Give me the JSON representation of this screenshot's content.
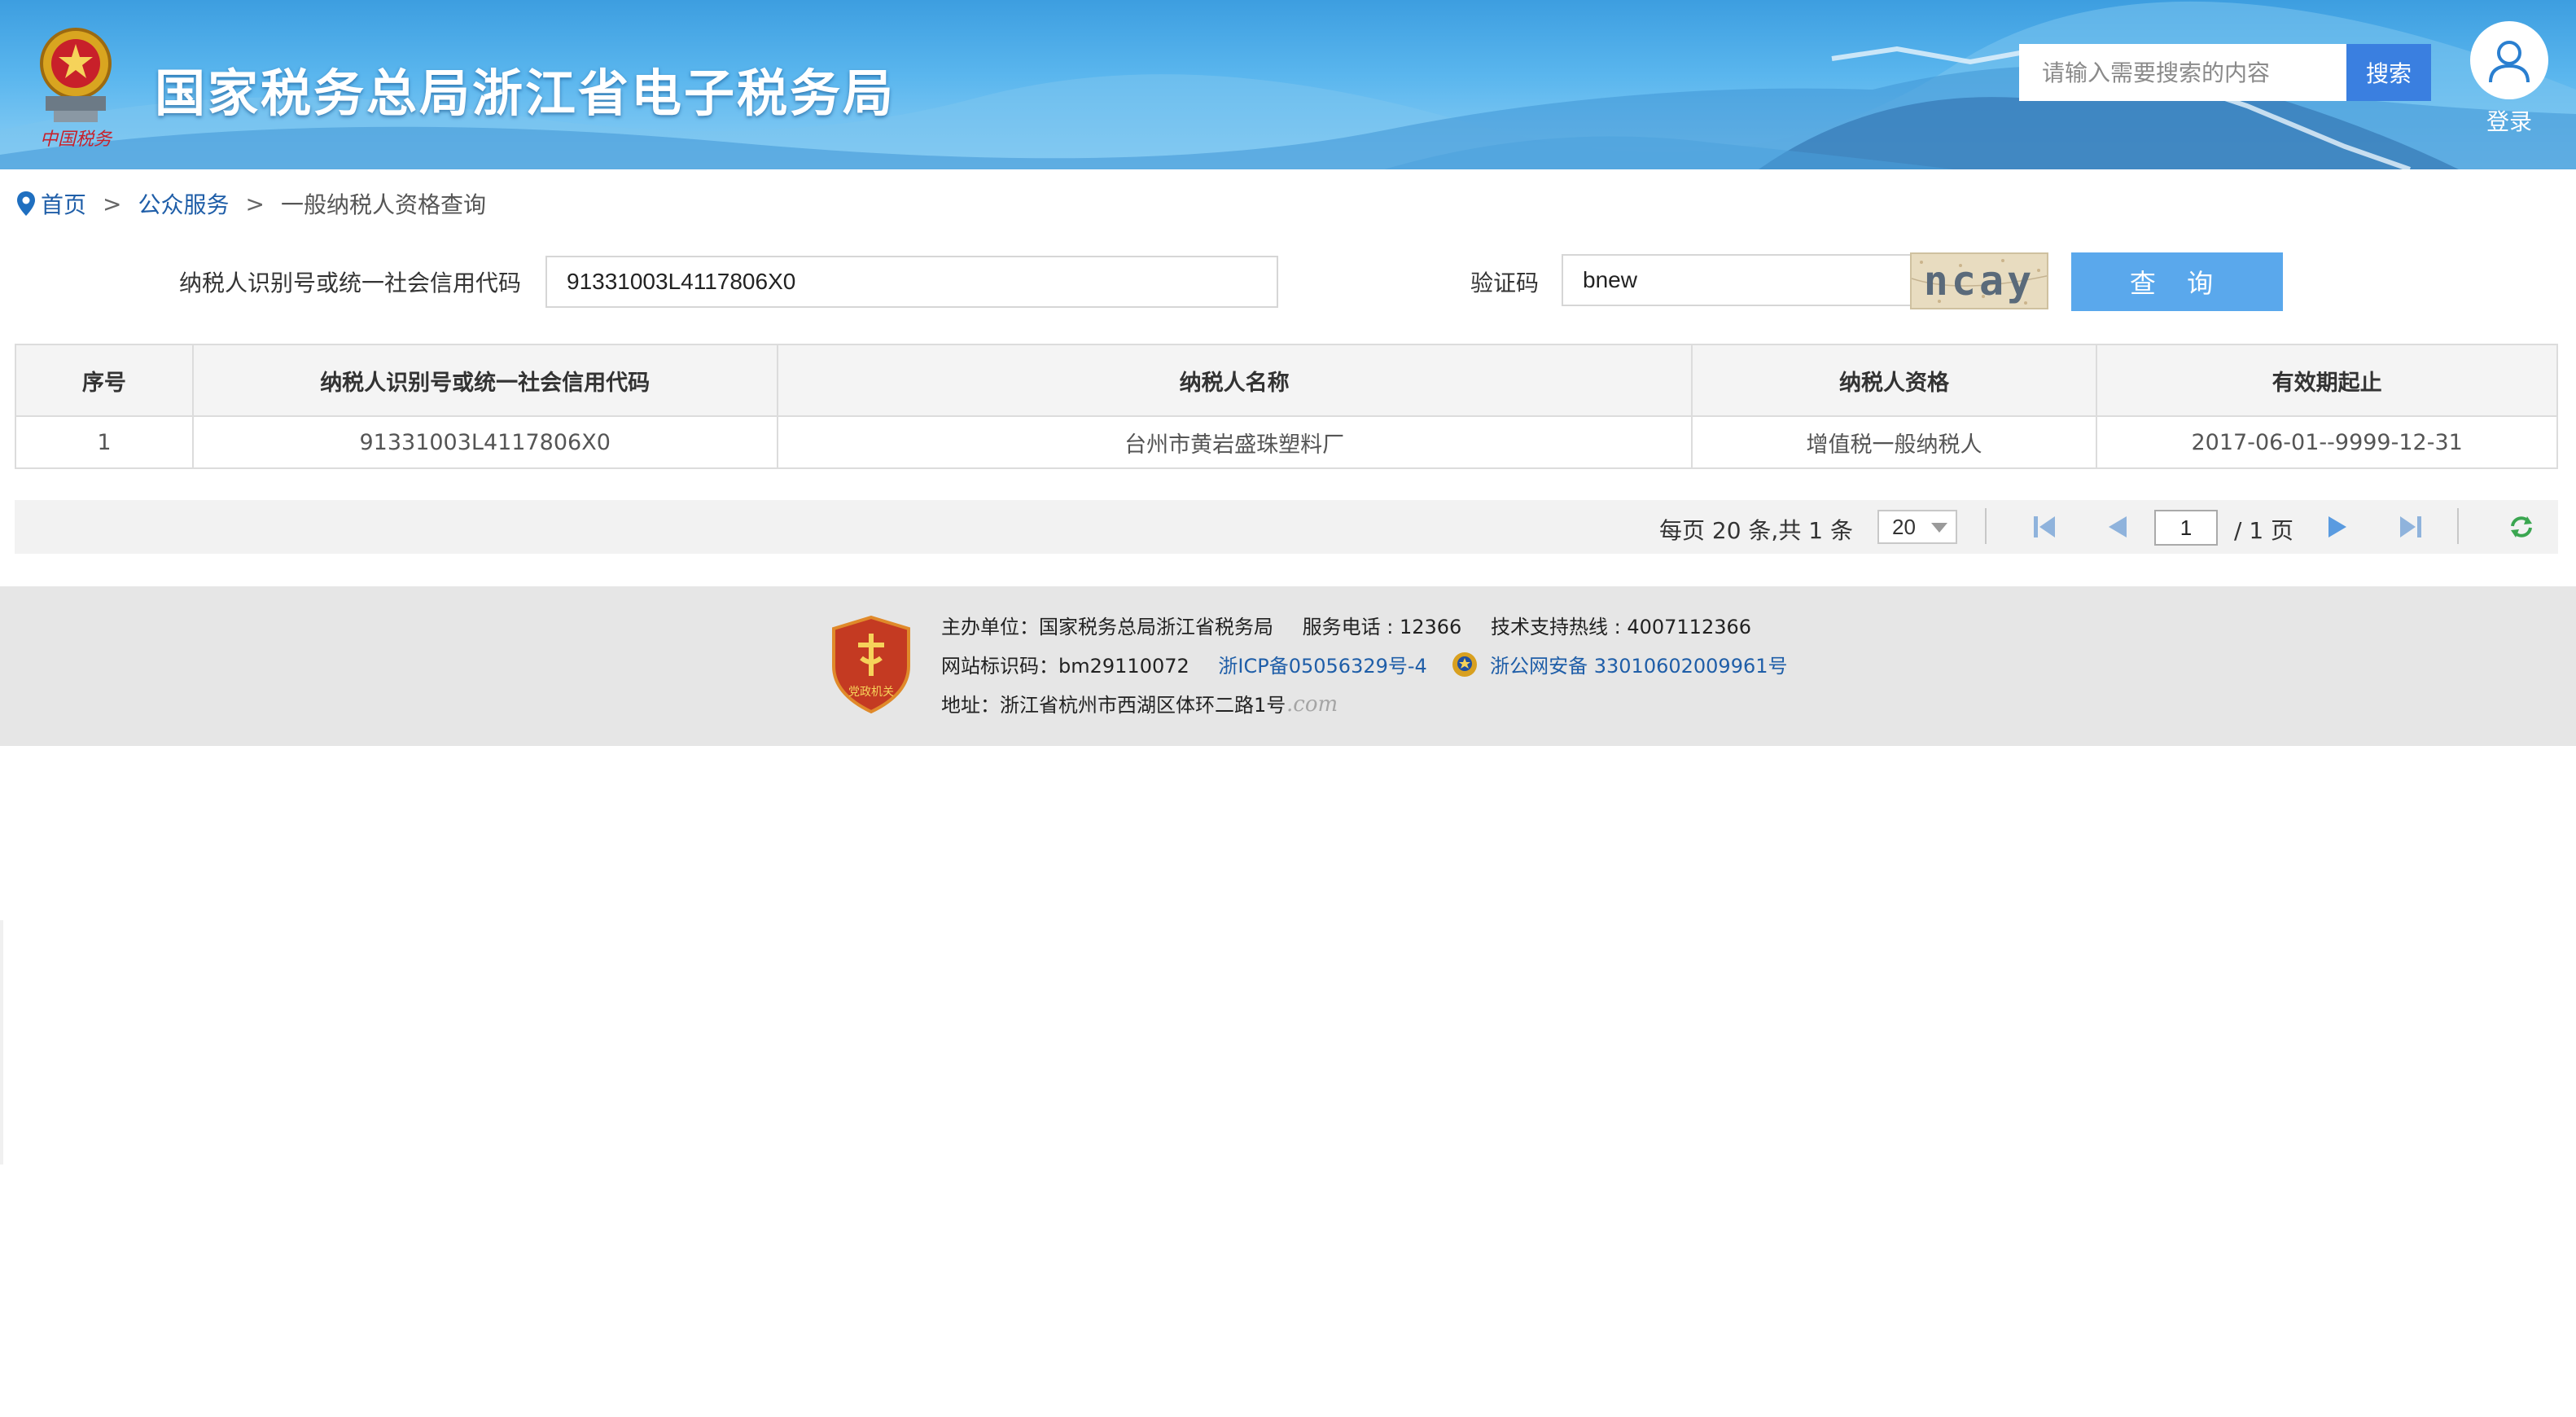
{
  "header": {
    "site_title": "国家税务总局浙江省电子税务局",
    "emblem_caption": "中国税务",
    "search_placeholder": "请输入需要搜索的内容",
    "search_button": "搜索",
    "login_label": "登录",
    "colors": {
      "banner": "#5ab6ee",
      "search_button": "#3a7fe0"
    }
  },
  "breadcrumb": {
    "home": "首页",
    "section": "公众服务",
    "current": "一般纳税人资格查询",
    "separator": ">"
  },
  "form": {
    "taxpayer_id_label": "纳税人识别号或统一社会信用代码",
    "taxpayer_id_value": "91331003L4117806X0",
    "captcha_label": "验证码",
    "captcha_value": "bnew",
    "captcha_image_text": "ncay",
    "query_button": "查 询"
  },
  "table": {
    "columns": [
      "序号",
      "纳税人识别号或统一社会信用代码",
      "纳税人名称",
      "纳税人资格",
      "有效期起止"
    ],
    "rows": [
      [
        "1",
        "91331003L4117806X0",
        "台州市黄岩盛珠塑料厂",
        "增值税一般纳税人",
        "2017-06-01--9999-12-31"
      ]
    ]
  },
  "pagination": {
    "summary": "每页 20 条,共 1 条",
    "page_size": "20",
    "current_page": "1",
    "total_pages": "/ 1 页"
  },
  "footer": {
    "host": "主办单位：国家税务总局浙江省税务局",
    "service_phone": "服务电话 : 12366",
    "support_hotline": "技术支持热线 : 4007112366",
    "site_id": "网站标识码：bm29110072",
    "icp": "浙ICP备05056329号-4",
    "police_record": "浙公网安备 33010602009961号",
    "address": "地址：浙江省杭州市西湖区体环二路1号",
    "badge_text": "党政机关",
    "watermark": ".com"
  }
}
